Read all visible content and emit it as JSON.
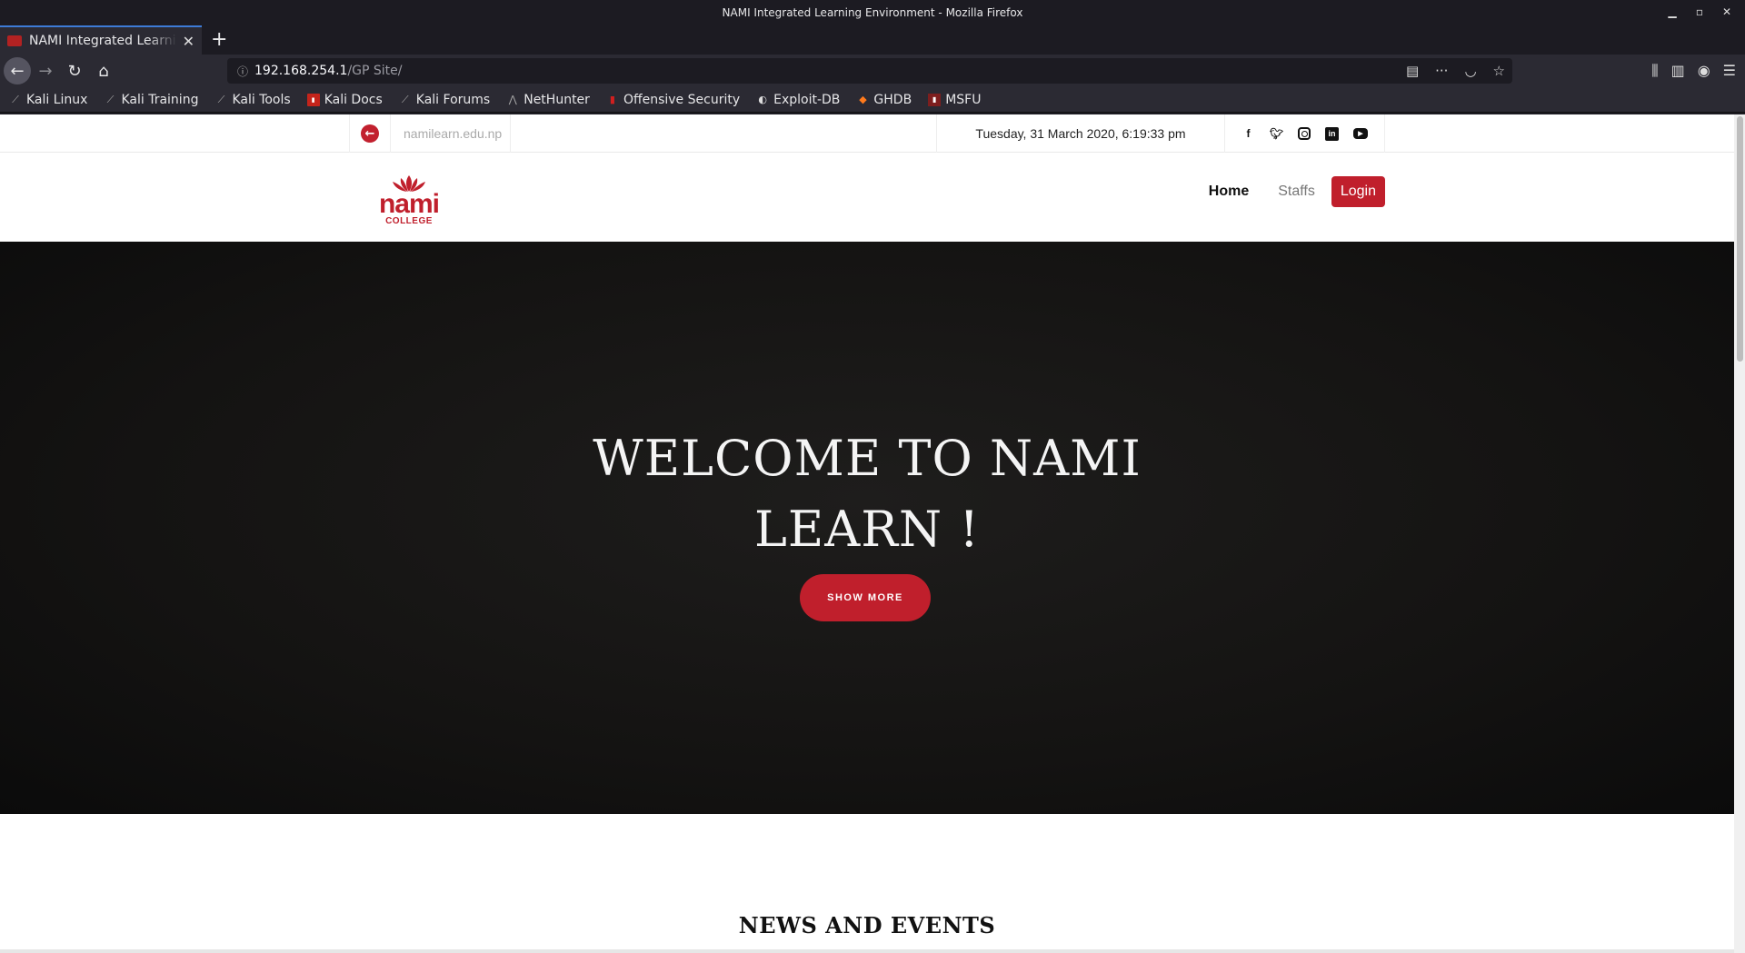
{
  "window": {
    "title": "NAMI Integrated Learning Environment - Mozilla Firefox"
  },
  "tab": {
    "label": "NAMI Integrated Learning Environment"
  },
  "url": {
    "host": "192.168.254.1",
    "path": "/GP Site/"
  },
  "bookmarks": [
    {
      "label": "Kali Linux",
      "icon": "kali-dragon-icon"
    },
    {
      "label": "Kali Training",
      "icon": "kali-dragon-icon"
    },
    {
      "label": "Kali Tools",
      "icon": "kali-dragon-icon"
    },
    {
      "label": "Kali Docs",
      "icon": "kali-docs-icon"
    },
    {
      "label": "Kali Forums",
      "icon": "kali-dragon-icon"
    },
    {
      "label": "NetHunter",
      "icon": "nethunter-icon"
    },
    {
      "label": "Offensive Security",
      "icon": "offsec-icon"
    },
    {
      "label": "Exploit-DB",
      "icon": "exploitdb-icon"
    },
    {
      "label": "GHDB",
      "icon": "ghdb-icon"
    },
    {
      "label": "MSFU",
      "icon": "msfu-icon"
    }
  ],
  "topbar": {
    "domain": "namilearn.edu.np",
    "datetime": "Tuesday, 31 March 2020, 6:19:33 pm",
    "social": [
      "facebook-icon",
      "twitter-icon",
      "instagram-icon",
      "linkedin-icon",
      "youtube-icon"
    ]
  },
  "logo": {
    "name": "nami",
    "subtitle": "COLLEGE",
    "color": "#c01f2c"
  },
  "menu": {
    "home": "Home",
    "staffs": "Staffs",
    "login": "Login"
  },
  "hero": {
    "line1": "WELCOME TO NAMI",
    "line2": "LEARN !",
    "button": "SHOW MORE"
  },
  "sections": {
    "news_title": "NEWS AND EVENTS"
  },
  "colors": {
    "accent": "#c01f2c",
    "hero_bg": "#141312",
    "chrome_bg": "#2b2a33"
  }
}
